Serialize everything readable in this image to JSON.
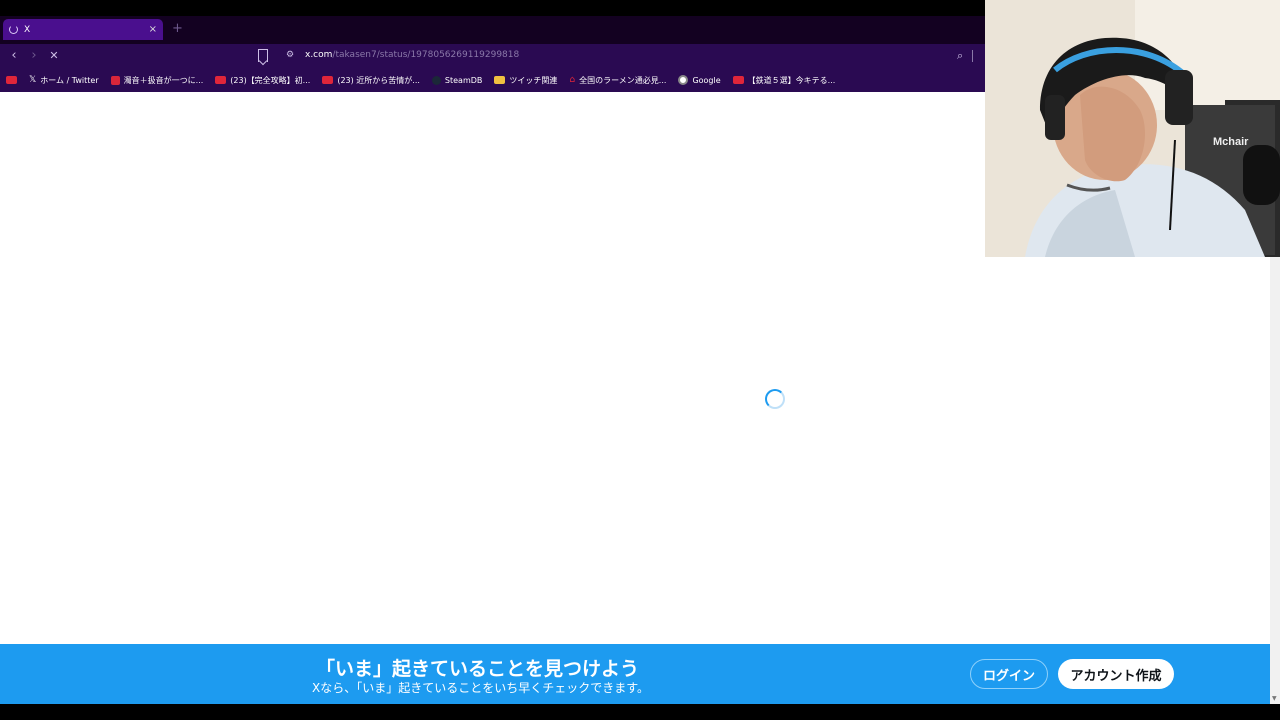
{
  "tab": {
    "title": "X",
    "close": "×",
    "new": "+"
  },
  "toolbar": {
    "url_host": "x.com",
    "url_path": "/takasen7/status/1978056269119299818",
    "back": "‹",
    "forward": "›",
    "stop": "✕"
  },
  "bookmarks": [
    {
      "label": "",
      "icon": "youtube-icon"
    },
    {
      "label": "ホーム / Twitter",
      "icon": "x-icon"
    },
    {
      "label": "濁音＋扱音が一つに...",
      "icon": "red-square-icon"
    },
    {
      "label": "(23)【完全攻略】初...",
      "icon": "youtube-icon"
    },
    {
      "label": "(23) 近所から苦情が...",
      "icon": "youtube-icon"
    },
    {
      "label": "SteamDB",
      "icon": "steam-icon"
    },
    {
      "label": "ツイッチ関連",
      "icon": "folder-icon"
    },
    {
      "label": "全国のラーメン通必見...",
      "icon": "ramen-icon"
    },
    {
      "label": "Google",
      "icon": "google-icon"
    },
    {
      "label": "【鉄道５選】今キテる...",
      "icon": "youtube-icon"
    }
  ],
  "banner": {
    "title": "「いま」起きていることを見つけよう",
    "subtitle": "Xなら、「いま」起きていることをいち早くチェックできます。",
    "login": "ログイン",
    "signup": "アカウント作成"
  },
  "webcam": {
    "chair_text": "Mchair"
  },
  "colors": {
    "accent": "#1d9bf0",
    "tab_active": "#4a0f8e",
    "toolbar": "#2a0a52"
  }
}
